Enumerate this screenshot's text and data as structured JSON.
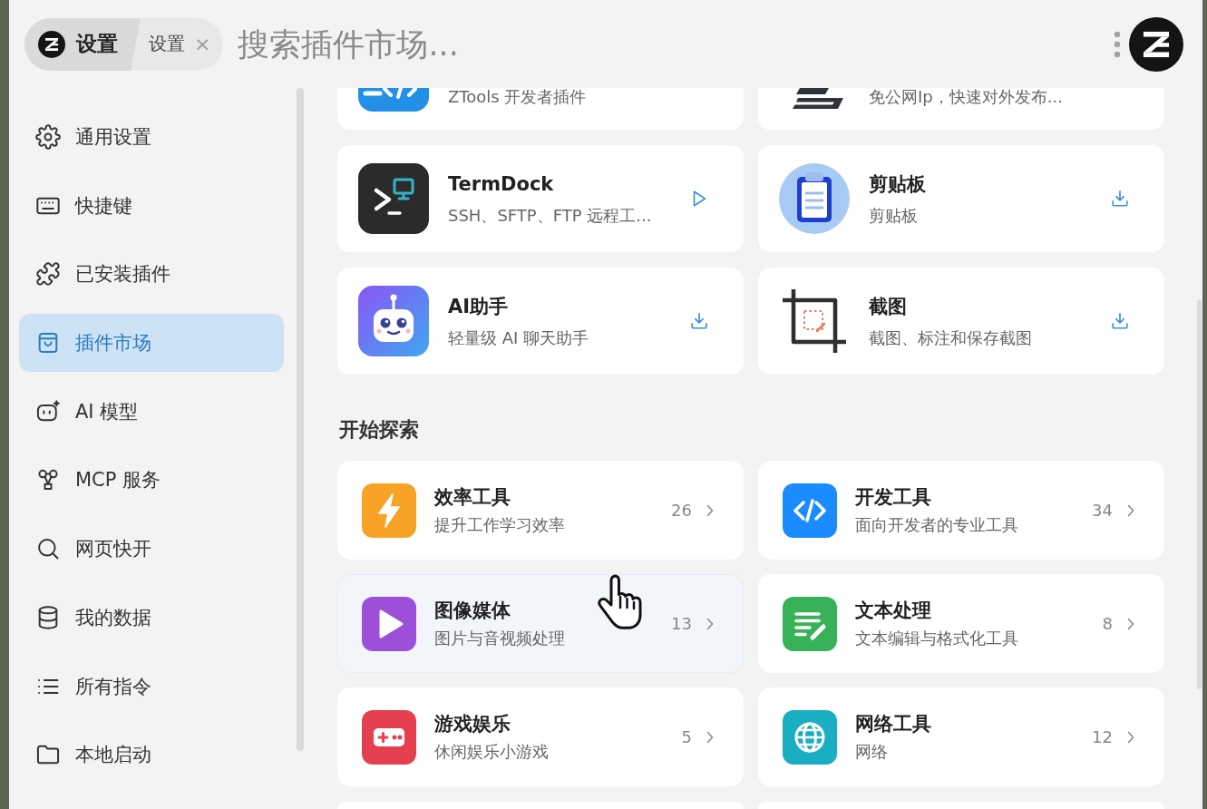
{
  "header": {
    "tab": {
      "title": "设置",
      "label": "设置",
      "close": "×"
    },
    "search": {
      "placeholder": "搜索插件市场..."
    }
  },
  "sidebar": {
    "items": [
      {
        "label": "通用设置",
        "selected": false
      },
      {
        "label": "快捷键",
        "selected": false
      },
      {
        "label": "已安装插件",
        "selected": false
      },
      {
        "label": "插件市场",
        "selected": true
      },
      {
        "label": "AI 模型",
        "selected": false
      },
      {
        "label": "MCP 服务",
        "selected": false
      },
      {
        "label": "网页快开",
        "selected": false
      },
      {
        "label": "我的数据",
        "selected": false
      },
      {
        "label": "所有指令",
        "selected": false
      },
      {
        "label": "本地启动",
        "selected": false
      }
    ]
  },
  "plugins": {
    "partial_row": [
      {
        "description": "ZTools 开发者插件"
      },
      {
        "description": "免公网Ip，快速对外发布..."
      }
    ],
    "items": [
      {
        "title": "TermDock",
        "description": "SSH、SFTP、FTP 远程工...",
        "installed": true
      },
      {
        "title": "剪贴板",
        "description": "剪贴板",
        "installed": false
      },
      {
        "title": "AI助手",
        "description": "轻量级 AI 聊天助手",
        "installed": false
      },
      {
        "title": "截图",
        "description": "截图、标注和保存截图",
        "installed": false
      }
    ]
  },
  "explore": {
    "title": "开始探索",
    "categories": [
      {
        "title": "效率工具",
        "description": "提升工作学习效率",
        "count": "26",
        "color": "#f7a325",
        "hovered": false
      },
      {
        "title": "开发工具",
        "description": "面向开发者的专业工具",
        "count": "34",
        "color": "#1a8cff",
        "hovered": false
      },
      {
        "title": "图像媒体",
        "description": "图片与音视频处理",
        "count": "13",
        "color": "#9c4fd9",
        "hovered": true
      },
      {
        "title": "文本处理",
        "description": "文本编辑与格式化工具",
        "count": "8",
        "color": "#37b258",
        "hovered": false
      },
      {
        "title": "游戏娱乐",
        "description": "休闲娱乐小游戏",
        "count": "5",
        "color": "#e5404f",
        "hovered": false
      },
      {
        "title": "网络工具",
        "description": "网络",
        "count": "12",
        "color": "#1aaec2",
        "hovered": false
      }
    ]
  }
}
